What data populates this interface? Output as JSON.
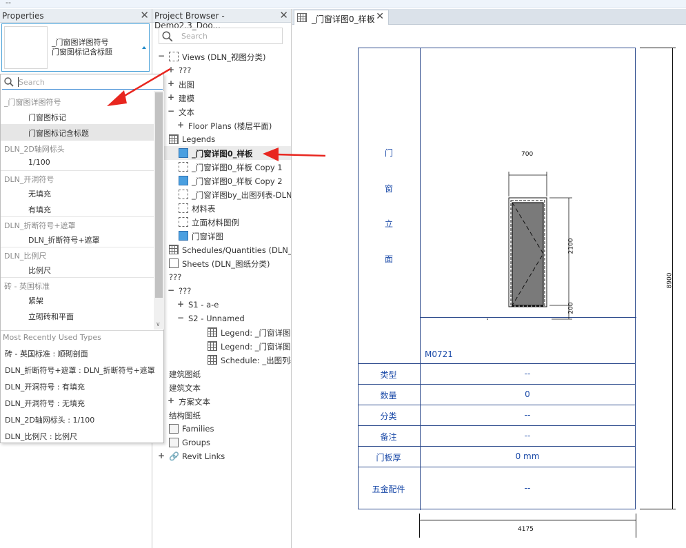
{
  "top_strip": {
    "text": "--"
  },
  "properties": {
    "title": "Properties",
    "type_selector": {
      "line1": "_门窗图详图符号",
      "line2": "门窗图标记含标题"
    },
    "dropdown": {
      "search_placeholder": "Search",
      "groups": [
        {
          "name": "_门窗图详图符号",
          "items": [
            "门窗图标记",
            "门窗图标记含标题"
          ],
          "selected": 1
        },
        {
          "name": "DLN_2D轴网标头",
          "items": [
            "1/100"
          ]
        },
        {
          "name": "DLN_开洞符号",
          "items": [
            "无填充",
            "有填充"
          ]
        },
        {
          "name": "DLN_折断符号+遮罩",
          "items": [
            "DLN_折断符号+遮罩"
          ]
        },
        {
          "name": "DLN_比例尺",
          "items": [
            "比例尺"
          ]
        },
        {
          "name": "砖 - 英国标准",
          "items": [
            "紧架",
            "立砌砖和平面"
          ]
        }
      ],
      "mru_title": "Most Recently Used Types",
      "mru_items": [
        "砖 - 英国标准 : 顺砌剖面",
        "DLN_折断符号+遮罩 : DLN_折断符号+遮罩",
        "DLN_开洞符号 : 有填充",
        "DLN_开洞符号 : 无填充",
        "DLN_2D轴网标头 : 1/100",
        "DLN_比例尺 : 比例尺"
      ]
    }
  },
  "browser": {
    "title": "Project Browser - Demo2.3_Doo...",
    "search_placeholder": "Search",
    "tree": [
      {
        "indent": 0,
        "toggle": "−",
        "icon": "view",
        "label": "Views (DLN_视图分类)"
      },
      {
        "indent": 1,
        "toggle": "+",
        "icon": "",
        "label": "???"
      },
      {
        "indent": 1,
        "toggle": "+",
        "icon": "",
        "label": "出图"
      },
      {
        "indent": 1,
        "toggle": "+",
        "icon": "",
        "label": "建模"
      },
      {
        "indent": 1,
        "toggle": "−",
        "icon": "",
        "label": "文本"
      },
      {
        "indent": 2,
        "toggle": "+",
        "icon": "",
        "label": "Floor Plans (楼层平面)"
      },
      {
        "indent": 0,
        "toggle": "",
        "icon": "grid",
        "label": "Legends"
      },
      {
        "indent": 1,
        "toggle": "",
        "icon": "blue",
        "label": "_门窗详图0_样板",
        "selected": true
      },
      {
        "indent": 1,
        "toggle": "",
        "icon": "view",
        "label": "_门窗详图0_样板 Copy 1"
      },
      {
        "indent": 1,
        "toggle": "",
        "icon": "blue",
        "label": "_门窗详图0_样板 Copy 2"
      },
      {
        "indent": 1,
        "toggle": "",
        "icon": "view",
        "label": "_门窗详图by_出图列表-DLN"
      },
      {
        "indent": 1,
        "toggle": "",
        "icon": "view",
        "label": "材料表"
      },
      {
        "indent": 1,
        "toggle": "",
        "icon": "view",
        "label": "立面材料图例"
      },
      {
        "indent": 1,
        "toggle": "",
        "icon": "blue",
        "label": "门窗详图"
      },
      {
        "indent": 0,
        "toggle": "",
        "icon": "grid",
        "label": "Schedules/Quantities (DLN_明细表)"
      },
      {
        "indent": 0,
        "toggle": "",
        "icon": "sheet",
        "label": "Sheets (DLN_图纸分类)"
      },
      {
        "indent": 0,
        "toggle": "−",
        "icon": "",
        "label": "???"
      },
      {
        "indent": 1,
        "toggle": "−",
        "icon": "",
        "label": "???"
      },
      {
        "indent": 2,
        "toggle": "+",
        "icon": "",
        "label": "S1 - a-e"
      },
      {
        "indent": 2,
        "toggle": "−",
        "icon": "",
        "label": "S2 - Unnamed"
      },
      {
        "indent": 4,
        "toggle": "",
        "icon": "grid",
        "label": "Legend: _门窗详图"
      },
      {
        "indent": 4,
        "toggle": "",
        "icon": "grid",
        "label": "Legend: _门窗详图"
      },
      {
        "indent": 4,
        "toggle": "",
        "icon": "grid",
        "label": "Schedule: _出图列表"
      },
      {
        "indent": 0,
        "toggle": "+",
        "icon": "",
        "label": "建筑图纸"
      },
      {
        "indent": 0,
        "toggle": "−",
        "icon": "",
        "label": "建筑文本"
      },
      {
        "indent": 1,
        "toggle": "+",
        "icon": "",
        "label": "方案文本"
      },
      {
        "indent": 0,
        "toggle": "+",
        "icon": "",
        "label": "结构图纸"
      },
      {
        "indent": 0,
        "toggle": "",
        "icon": "fam",
        "label": "Families"
      },
      {
        "indent": 0,
        "toggle": "",
        "icon": "fam",
        "label": "Groups"
      },
      {
        "indent": 0,
        "toggle": "+",
        "icon": "link",
        "label": "Revit Links"
      }
    ]
  },
  "view": {
    "tab_label": "_门窗详图0_样板",
    "vertical_title": [
      "门",
      "窗",
      "立",
      "面"
    ],
    "mark": "M0721",
    "dims": {
      "width": "700",
      "height": "2100",
      "sill": "200",
      "total_height": "8900",
      "bottom": "4175"
    },
    "params": [
      {
        "key": "类型",
        "value": "--"
      },
      {
        "key": "数量",
        "value": "0"
      },
      {
        "key": "分类",
        "value": "--"
      },
      {
        "key": "备注",
        "value": "--"
      },
      {
        "key": "门板厚",
        "value": "0 mm"
      },
      {
        "key": "五金配件",
        "value": "--"
      }
    ]
  },
  "colors": {
    "accent": "#1b4aa8",
    "selection_blue": "#4a9fe0",
    "arrow": "#e8261f"
  }
}
